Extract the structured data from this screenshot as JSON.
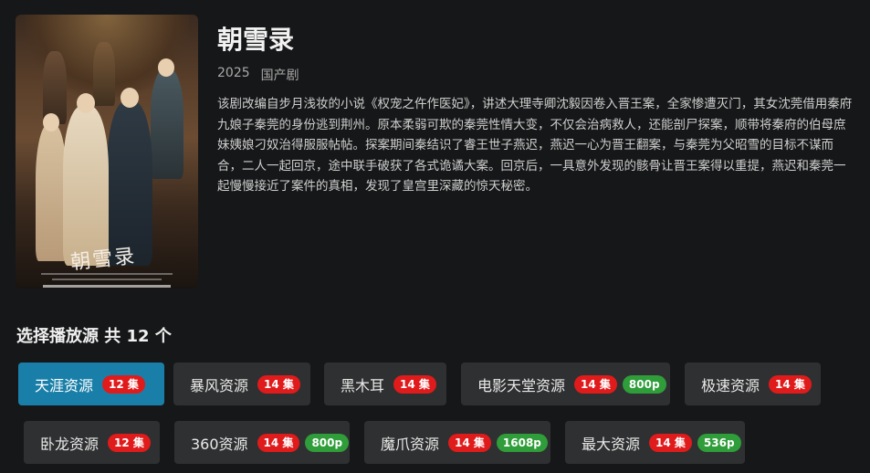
{
  "show": {
    "title": "朝雪录",
    "year": "2025",
    "genre": "国产剧",
    "description": "该剧改编自步月浅妆的小说《权宠之仵作医妃》，讲述大理寺卿沈毅因卷入晋王案，全家惨遭灭门，其女沈莞借用秦府九娘子秦莞的身份逃到荆州。原本柔弱可欺的秦莞性情大变，不仅会治病救人，还能剖尸探案，顺带将秦府的伯母庶妹姨娘刁奴治得服服帖帖。探案期间秦结识了睿王世子燕迟，燕迟一心为晋王翻案，与秦莞为父昭雪的目标不谋而合，二人一起回京，途中联手破获了各式诡谲大案。回京后，一具意外发现的骸骨让晋王案得以重提，燕迟和秦莞一起慢慢接近了案件的真相，发现了皇宫里深藏的惊天秘密。",
    "poster_text": "朝雪录"
  },
  "sources": {
    "heading": "选择播放源 共 12 个",
    "items": [
      {
        "label": "天涯资源",
        "episodes": "12 集",
        "resolution": null,
        "active": true
      },
      {
        "label": "暴风资源",
        "episodes": "14 集",
        "resolution": null,
        "active": false
      },
      {
        "label": "黑木耳",
        "episodes": "14 集",
        "resolution": null,
        "active": false
      },
      {
        "label": "电影天堂资源",
        "episodes": "14 集",
        "resolution": "800p",
        "active": false
      },
      {
        "label": "极速资源",
        "episodes": "14 集",
        "resolution": null,
        "active": false
      },
      {
        "label": "卧龙资源",
        "episodes": "12 集",
        "resolution": null,
        "active": false
      },
      {
        "label": "360资源",
        "episodes": "14 集",
        "resolution": "800p",
        "active": false
      },
      {
        "label": "魔爪资源",
        "episodes": "14 集",
        "resolution": "1608p",
        "active": false
      },
      {
        "label": "最大资源",
        "episodes": "14 集",
        "resolution": "536p",
        "active": false
      }
    ]
  },
  "colors": {
    "background": "#161718",
    "active_button": "#1a7fa8",
    "button": "#2f3031",
    "episode_badge": "#e01b1b",
    "resolution_badge": "#2f9d3a"
  }
}
